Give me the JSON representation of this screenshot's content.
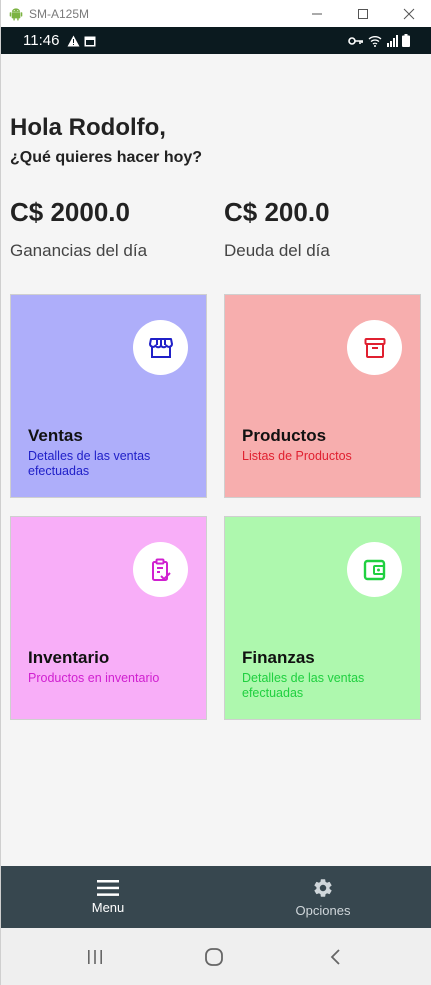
{
  "window": {
    "title": "SM-A125M"
  },
  "statusbar": {
    "time": "11:46"
  },
  "home": {
    "greeting": "Hola Rodolfo,",
    "subtitle": "¿Qué quieres hacer hoy?",
    "earnings": {
      "amount": "C$ 2000.0",
      "label": "Ganancias del día"
    },
    "debt": {
      "amount": "C$ 200.0",
      "label": "Deuda del día"
    }
  },
  "cards": [
    {
      "title": "Ventas",
      "subtitle": "Detalles de las ventas efectuadas",
      "icon": "store-icon",
      "bg": "#aeaefa",
      "accent": "#2020c8"
    },
    {
      "title": "Productos",
      "subtitle": "Listas de Productos",
      "icon": "archive-box-icon",
      "bg": "#f7aeae",
      "accent": "#e02030"
    },
    {
      "title": "Inventario",
      "subtitle": "Productos en inventario",
      "icon": "clipboard-check-icon",
      "bg": "#f8aef8",
      "accent": "#d020d0"
    },
    {
      "title": "Finanzas",
      "subtitle": "Detalles de las ventas efectuadas",
      "icon": "wallet-icon",
      "bg": "#aef8ae",
      "accent": "#20d040"
    }
  ],
  "bottomnav": {
    "menu_label": "Menu",
    "options_label": "Opciones"
  }
}
